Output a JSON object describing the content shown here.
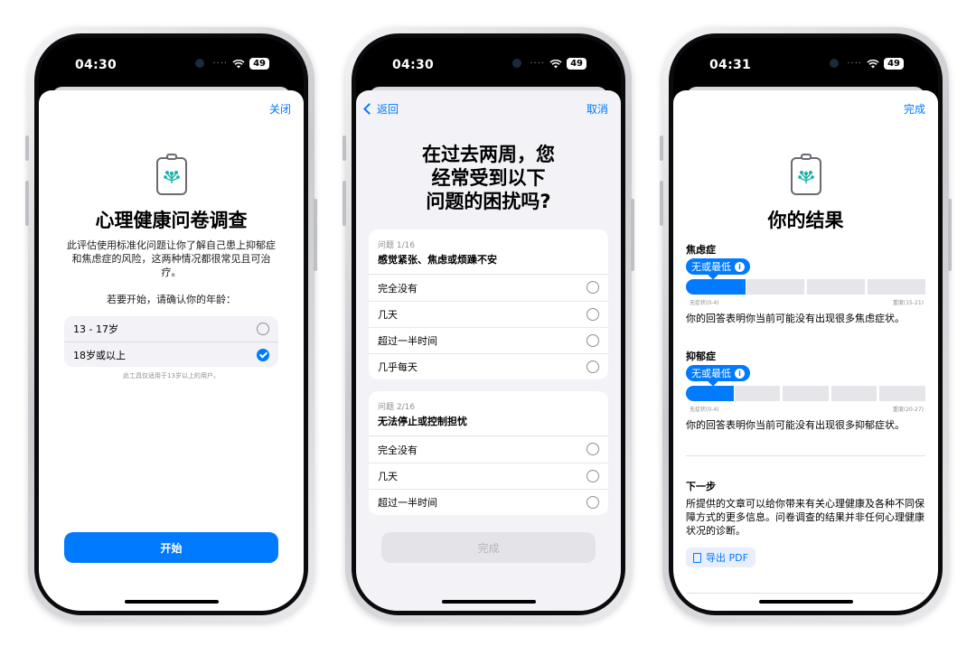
{
  "status": {
    "phone1_time": "04:30",
    "phone2_time": "04:30",
    "phone3_time": "04:31",
    "battery": "49"
  },
  "intro": {
    "close_label": "关闭",
    "title": "心理健康问卷调查",
    "description": "此评估使用标准化问题让你了解自己患上抑郁症和焦虑症的风险，这两种情况都很常见且可治疗。",
    "age_prompt": "若要开始，请确认你的年龄：",
    "age_options": [
      {
        "label": "13 - 17岁",
        "checked": false
      },
      {
        "label": "18岁或以上",
        "checked": true
      }
    ],
    "note": "此工具仅适用于13岁以上的用户。",
    "start_label": "开始"
  },
  "questionnaire": {
    "back_label": "返回",
    "cancel_label": "取消",
    "heading_lines": [
      "在过去两周，您",
      "经常受到以下",
      "问题的困扰吗?"
    ],
    "questions": [
      {
        "number": "问题 1/16",
        "text": "感觉紧张、焦虑或烦躁不安",
        "options": [
          "完全没有",
          "几天",
          "超过一半时间",
          "几乎每天"
        ]
      },
      {
        "number": "问题 2/16",
        "text": "无法停止或控制担忧",
        "options": [
          "完全没有",
          "几天",
          "超过一半时间"
        ]
      }
    ],
    "done_label": "完成"
  },
  "results": {
    "done_label": "完成",
    "title": "你的结果",
    "anxiety": {
      "heading": "焦虑症",
      "badge": "无或最低",
      "info_glyph": "i",
      "level_fraction": 0.25,
      "low_label": "无症状(0-4)",
      "high_label": "重度(15-21)",
      "description": "你的回答表明你当前可能没有出现很多焦虑症状。"
    },
    "depression": {
      "heading": "抑郁症",
      "badge": "无或最低",
      "info_glyph": "i",
      "level_fraction": 0.2,
      "low_label": "无症状(0-4)",
      "high_label": "重度(20-27)",
      "description": "你的回答表明你当前可能没有出现很多抑郁症状。"
    },
    "next": {
      "heading": "下一步",
      "text": "所提供的文章可以给你带来有关心理健康及各种不同保障方式的更多信息。问卷调查的结果并非任何心理健康状况的诊断。",
      "export_label": "导出 PDF"
    }
  },
  "colors": {
    "accent": "#007aff",
    "grouped_bg": "#f2f2f7"
  }
}
